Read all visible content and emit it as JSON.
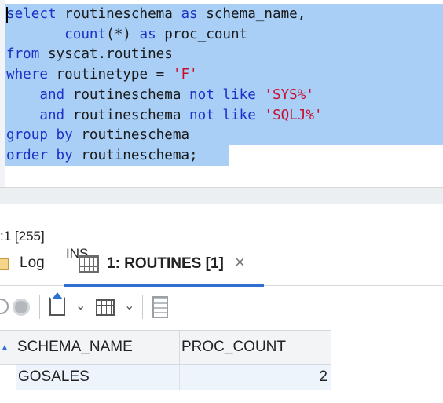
{
  "editor": {
    "lines": [
      [
        {
          "t": "select",
          "c": "kw"
        },
        {
          "t": " routineschema ",
          "c": ""
        },
        {
          "t": "as",
          "c": "kw"
        },
        {
          "t": " schema_name,",
          "c": ""
        }
      ],
      [
        {
          "t": "       ",
          "c": ""
        },
        {
          "t": "count",
          "c": "kw"
        },
        {
          "t": "(*) ",
          "c": ""
        },
        {
          "t": "as",
          "c": "kw"
        },
        {
          "t": " proc_count",
          "c": ""
        }
      ],
      [
        {
          "t": "from",
          "c": "kw"
        },
        {
          "t": " syscat.routines",
          "c": ""
        }
      ],
      [
        {
          "t": "where",
          "c": "kw"
        },
        {
          "t": " routinetype = ",
          "c": ""
        },
        {
          "t": "'F'",
          "c": "str"
        }
      ],
      [
        {
          "t": "    ",
          "c": ""
        },
        {
          "t": "and",
          "c": "kw"
        },
        {
          "t": " routineschema ",
          "c": ""
        },
        {
          "t": "not like",
          "c": "kw"
        },
        {
          "t": " ",
          "c": ""
        },
        {
          "t": "'SYS%'",
          "c": "str"
        }
      ],
      [
        {
          "t": "    ",
          "c": ""
        },
        {
          "t": "and",
          "c": "kw"
        },
        {
          "t": " routineschema ",
          "c": ""
        },
        {
          "t": "not like",
          "c": "kw"
        },
        {
          "t": " ",
          "c": ""
        },
        {
          "t": "'SQLJ%'",
          "c": "str"
        }
      ],
      [
        {
          "t": "group by",
          "c": "kw"
        },
        {
          "t": " routineschema",
          "c": ""
        }
      ],
      [
        {
          "t": "order by",
          "c": "kw"
        },
        {
          "t": " routineschema;",
          "c": ""
        }
      ]
    ]
  },
  "status": {
    "position": ":1 [255]",
    "mode": "INS"
  },
  "tabs": {
    "log": "Log",
    "routines": "1: ROUTINES [1]",
    "close_glyph": "×"
  },
  "toolbar": {
    "chevron_glyph": "⌄"
  },
  "results": {
    "columns": [
      "SCHEMA_NAME",
      "PROC_COUNT"
    ],
    "rows": [
      [
        "GOSALES",
        "2"
      ]
    ],
    "row_marker": "▲"
  },
  "colors": {
    "selection": "#a9cff7",
    "keyword": "#1b32c7",
    "string": "#c8102e",
    "accent": "#2f6fd0"
  }
}
